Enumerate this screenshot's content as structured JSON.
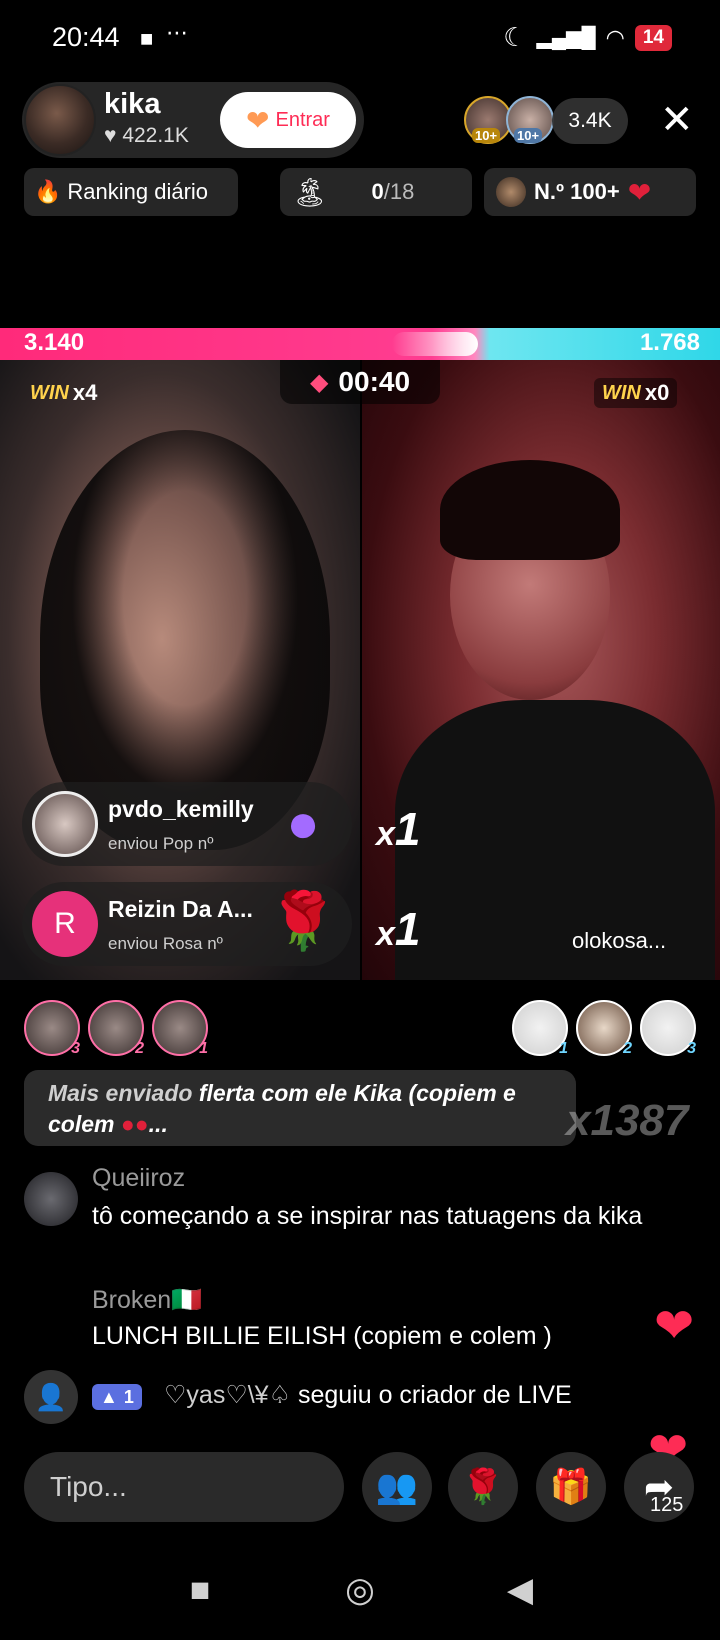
{
  "status": {
    "time": "20:44",
    "battery": "14"
  },
  "host": {
    "name": "kika",
    "likes": "422.1K",
    "join_label": "Entrar"
  },
  "viewers": {
    "badge1": "10+",
    "badge2": "10+",
    "count": "3.4K"
  },
  "chips": {
    "ranking": "Ranking diário",
    "goal_done": "0",
    "goal_total": "/18",
    "rank": "N.º 100+"
  },
  "battle": {
    "score_left": "3.140",
    "score_right": "1.768",
    "win_label": "WIN",
    "left_wins": "x4",
    "right_wins": "x0",
    "timer": "00:40",
    "guest_name": "olokosa..."
  },
  "gifts": [
    {
      "user": "pvdo_kemilly",
      "text": "enviou Pop nº",
      "combo": "1",
      "combo_prefix": "x"
    },
    {
      "user": "Reizin Da A...",
      "text": "enviou Rosa nº",
      "initial": "R",
      "combo": "1",
      "combo_prefix": "x"
    }
  ],
  "top_gifters_left": [
    "3",
    "2",
    "1"
  ],
  "top_gifters_right": [
    "1",
    "2",
    "3"
  ],
  "pinned": {
    "prefix": "Mais enviado",
    "text": "flerta com ele Kika (copiem e colem",
    "suffix": "...",
    "multiplier": "x1387"
  },
  "chat": [
    {
      "user": "Queiiroz",
      "msg": "tô começando a se inspirar nas tatuagens da kika"
    },
    {
      "user": "Broken🇮🇹",
      "msg": "LUNCH BILLIE EILISH (copiem e colem )"
    }
  ],
  "follow": {
    "level": "1",
    "user": "♡yas♡\\¥♤",
    "action": "seguiu o criador de LIVE"
  },
  "bottom": {
    "input_placeholder": "Tipo...",
    "share_count": "125"
  },
  "colors": {
    "accent": "#fe2c55",
    "blue_team": "#2fd7e8",
    "pink_team": "#ff2a7a"
  }
}
